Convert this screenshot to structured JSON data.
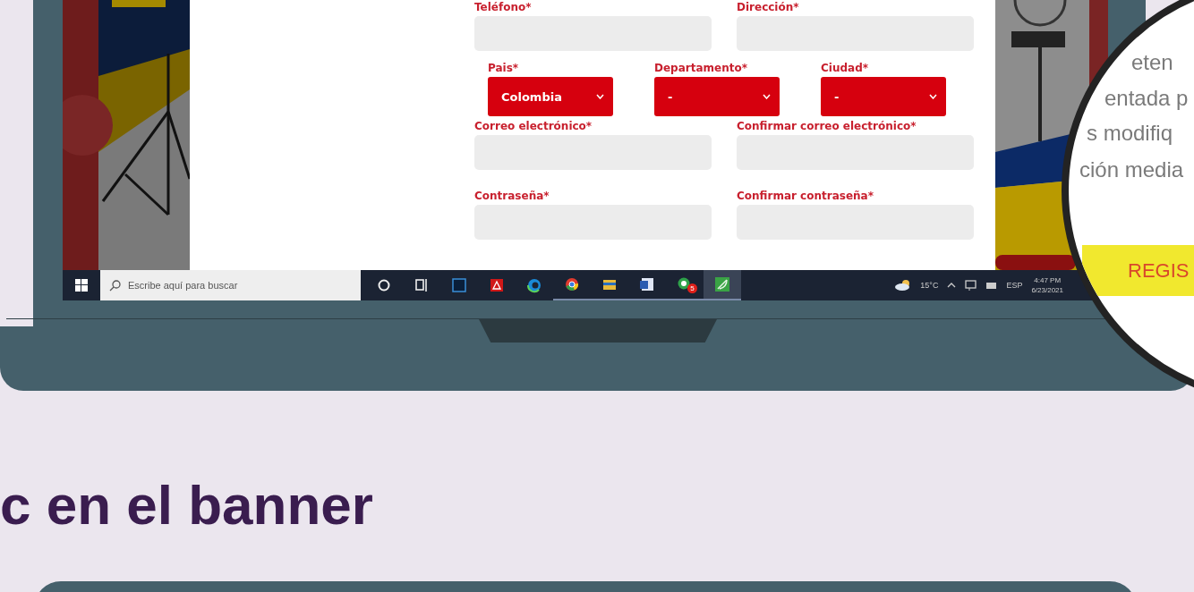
{
  "screen": {
    "form": {
      "rows": [
        {
          "fields": [
            {
              "kind": "text",
              "label": "Teléfono*"
            },
            {
              "kind": "text",
              "label": "Dirección*"
            }
          ]
        },
        {
          "fields": [
            {
              "kind": "select",
              "label": "Pais*",
              "value": "Colombia"
            },
            {
              "kind": "select",
              "label": "Departamento*",
              "value": "-"
            },
            {
              "kind": "select",
              "label": "Ciudad*",
              "value": "-"
            }
          ]
        },
        {
          "fields": [
            {
              "kind": "text",
              "label": "Correo electrónico*"
            },
            {
              "kind": "text",
              "label": "Confirmar correo electrónico*"
            }
          ]
        },
        {
          "fields": [
            {
              "kind": "text",
              "label": "Contraseña*"
            },
            {
              "kind": "text",
              "label": "Confirmar contraseña*"
            }
          ]
        }
      ]
    },
    "taskbar": {
      "search": {
        "placeholder": "Escribe aquí para buscar"
      },
      "apps": [
        {
          "kind": "cortana",
          "running": false,
          "selected": false
        },
        {
          "kind": "taskview",
          "running": false,
          "selected": false
        },
        {
          "kind": "ps",
          "running": false,
          "selected": false
        },
        {
          "kind": "pdf",
          "running": false,
          "selected": false
        },
        {
          "kind": "edge",
          "running": false,
          "selected": false
        },
        {
          "kind": "chrome",
          "running": true,
          "selected": false
        },
        {
          "kind": "folder",
          "running": true,
          "selected": false
        },
        {
          "kind": "word",
          "running": true,
          "selected": false
        },
        {
          "kind": "chat",
          "running": true,
          "selected": false,
          "badge": "5"
        },
        {
          "kind": "leaf",
          "running": true,
          "selected": true
        }
      ],
      "tray": {
        "temperature": "15°C",
        "language": "ESP",
        "time": "4:47 PM",
        "date": "6/23/2021"
      }
    }
  },
  "magnifier": {
    "lines": [
      "eten",
      "entada p",
      "s modifiq",
      "ción media"
    ],
    "button": "REGIS"
  },
  "heading": "c en el banner"
}
